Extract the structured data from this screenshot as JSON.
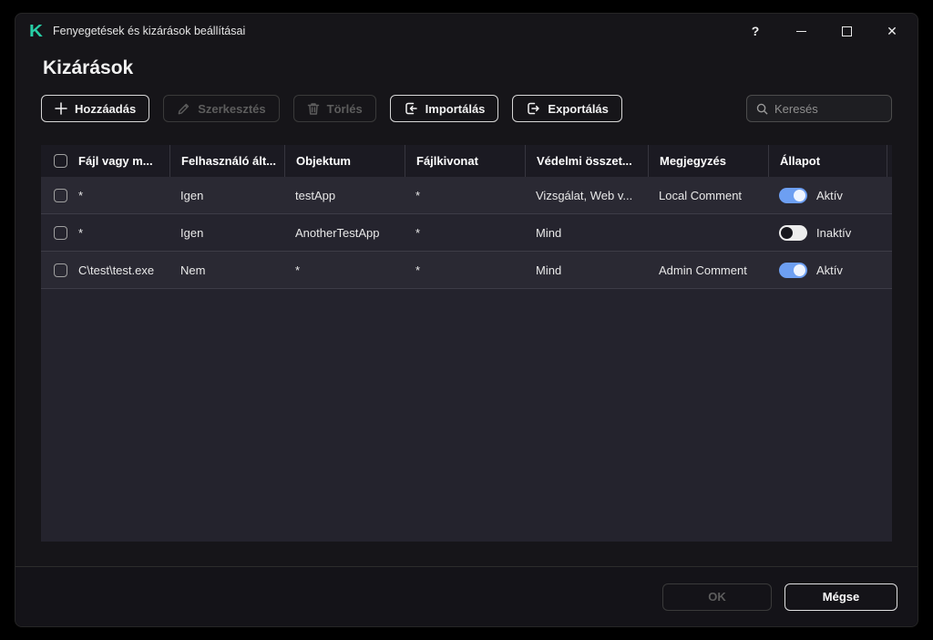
{
  "window": {
    "title": "Fenyegetések és kizárások beállításai",
    "controls": {
      "help": "?",
      "close": "✕"
    }
  },
  "page": {
    "heading": "Kizárások"
  },
  "toolbar": {
    "buttons": [
      {
        "label": "Hozzáadás",
        "icon": "plus-icon",
        "enabled": true
      },
      {
        "label": "Szerkesztés",
        "icon": "pencil-icon",
        "enabled": false
      },
      {
        "label": "Törlés",
        "icon": "trash-icon",
        "enabled": false
      },
      {
        "label": "Importálás",
        "icon": "import-icon",
        "enabled": true
      },
      {
        "label": "Exportálás",
        "icon": "export-icon",
        "enabled": true
      }
    ],
    "search_placeholder": "Keresés"
  },
  "table": {
    "columns": [
      "Fájl vagy m...",
      "Felhasználó ált...",
      "Objektum",
      "Fájlkivonat",
      "Védelmi összet...",
      "Megjegyzés",
      "Állapot"
    ],
    "rows": [
      {
        "file": "*",
        "user": "Igen",
        "object": "testApp",
        "hash": "*",
        "components": "Vizsgálat, Web v...",
        "comment": "Local Comment",
        "active": true,
        "status": "Aktív"
      },
      {
        "file": "*",
        "user": "Igen",
        "object": "AnotherTestApp",
        "hash": "*",
        "components": "Mind",
        "comment": "",
        "active": false,
        "status": "Inaktív"
      },
      {
        "file": "C\\test\\test.exe",
        "user": "Nem",
        "object": "*",
        "hash": "*",
        "components": "Mind",
        "comment": "Admin Comment",
        "active": true,
        "status": "Aktív"
      }
    ]
  },
  "footer": {
    "ok_label": "OK",
    "ok_enabled": false,
    "cancel_label": "Mégse"
  },
  "colors": {
    "brand_teal": "#27cfa6",
    "toggle_on": "#6d9ff2",
    "table_bg": "#24232d",
    "header_bg": "#1b1a22",
    "window_bg": "#161519"
  }
}
